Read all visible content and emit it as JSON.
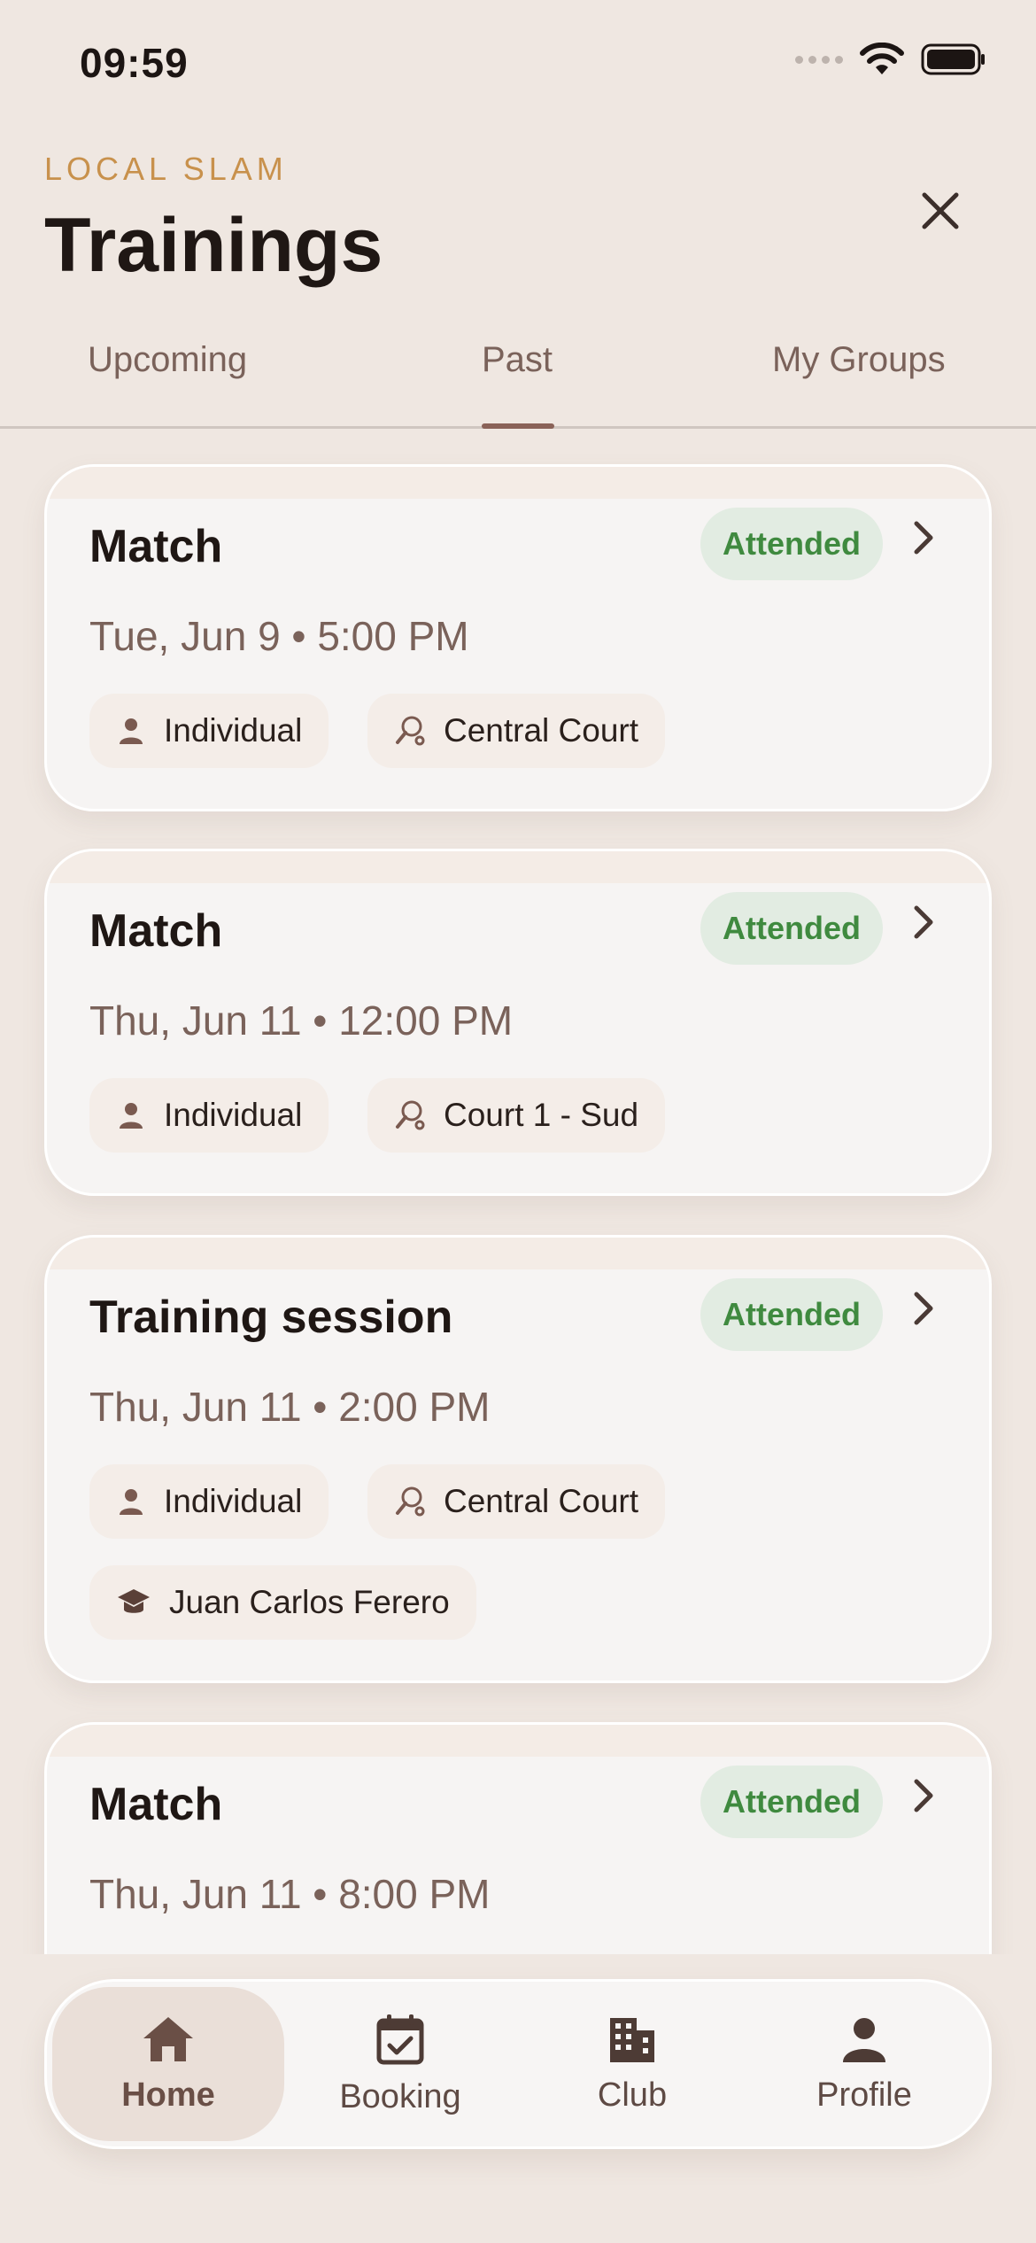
{
  "status": {
    "time": "09:59"
  },
  "header": {
    "brand": "LOCAL SLAM",
    "title": "Trainings"
  },
  "tabs": [
    {
      "label": "Upcoming"
    },
    {
      "label": "Past"
    },
    {
      "label": "My Groups"
    }
  ],
  "active_tab": "Past",
  "cards": [
    {
      "title": "Match",
      "status": "Attended",
      "date": "Tue, Jun 9 • 5:00 PM",
      "type": "Individual",
      "court": "Central Court",
      "coach": ""
    },
    {
      "title": "Match",
      "status": "Attended",
      "date": "Thu, Jun 11 • 12:00 PM",
      "type": "Individual",
      "court": "Court 1 - Sud",
      "coach": ""
    },
    {
      "title": "Training session",
      "status": "Attended",
      "date": "Thu, Jun 11 • 2:00 PM",
      "type": "Individual",
      "court": "Central Court",
      "coach": "Juan Carlos Ferero"
    },
    {
      "title": "Match",
      "status": "Attended",
      "date": "Thu, Jun 11 • 8:00 PM",
      "type": "",
      "court": "",
      "coach": ""
    }
  ],
  "nav": [
    {
      "label": "Home",
      "icon": "home-icon"
    },
    {
      "label": "Booking",
      "icon": "calendar-check-icon"
    },
    {
      "label": "Club",
      "icon": "building-icon"
    },
    {
      "label": "Profile",
      "icon": "person-icon"
    }
  ],
  "active_nav": "Home",
  "colors": {
    "background": "#efe7e1",
    "accent": "#c8914c",
    "badge_bg": "#e2ece2",
    "badge_text": "#3f8a3f",
    "tab_indicator": "#8a6258"
  }
}
